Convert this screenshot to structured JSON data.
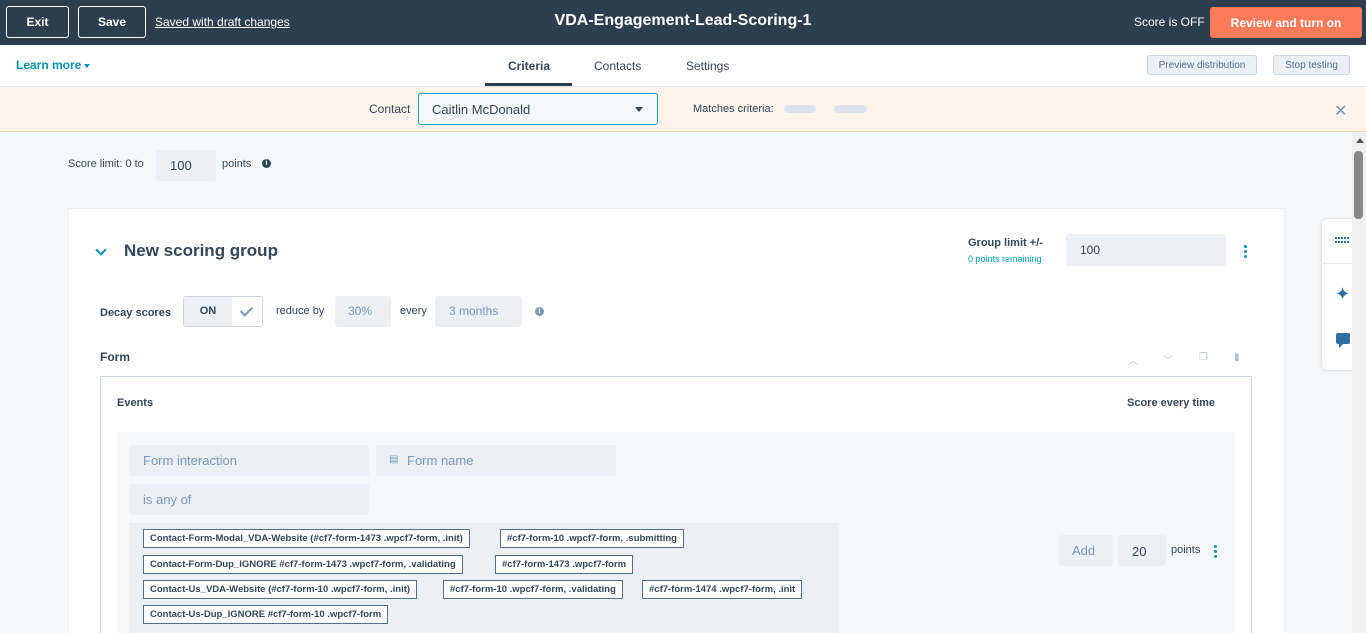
{
  "topbar": {
    "exit_label": "Exit",
    "save_label": "Save",
    "saved_status": "Saved with draft changes",
    "title": "VDA-Engagement-Lead-Scoring-1",
    "score_status": "Score is OFF",
    "review_label": "Review and turn on"
  },
  "tabbar": {
    "learn_more": "Learn more",
    "tabs": [
      {
        "label": "Criteria",
        "active": true
      },
      {
        "label": "Contacts",
        "active": false
      },
      {
        "label": "Settings",
        "active": false
      }
    ],
    "preview_label": "Preview distribution",
    "stop_label": "Stop testing"
  },
  "contactbar": {
    "label": "Contact",
    "selected_contact": "Caitlin McDonald",
    "matches_label": "Matches criteria:"
  },
  "score_limit": {
    "label": "Score limit: 0 to",
    "value": "100",
    "unit": "points"
  },
  "group": {
    "title": "New scoring group",
    "limit_label": "Group limit +/-",
    "points_remaining": "0 points remaining",
    "limit_value": "100",
    "decay_label": "Decay scores",
    "decay_toggle": "ON",
    "reduce_label": "reduce by",
    "reduce_value": "30%",
    "every_label": "every",
    "every_value": "3 months"
  },
  "form_section": {
    "label": "Form",
    "events_label": "Events",
    "score_mode": "Score every time",
    "event_type": "Form interaction",
    "property": "Form name",
    "operator": "is any of",
    "tags": [
      "Contact-Form-Modal_VDA-Website (#cf7-form-1473 .wpcf7-form, .init)",
      "#cf7-form-10 .wpcf7-form, .submitting",
      "Contact-Form-Dup_IGNORE #cf7-form-1473 .wpcf7-form, .validating",
      "#cf7-form-1473 .wpcf7-form",
      "Contact-Us_VDA-Website (#cf7-form-10 .wpcf7-form, .init)",
      "#cf7-form-10 .wpcf7-form, .validating",
      "#cf7-form-1474 .wpcf7-form, .init",
      "Contact-Us-Dup_IGNORE #cf7-form-10 .wpcf7-form"
    ],
    "action_label": "Add",
    "points_value": "20",
    "points_unit": "points"
  },
  "icons": {
    "close": "close-icon",
    "info": "info-icon",
    "chevron": "chevron-down-icon",
    "sparkle": "sparkle-icon",
    "chat": "chat-icon",
    "grid": "grid-icon"
  },
  "colors": {
    "topbar": "#2d3e50",
    "accent": "#ff7a59",
    "link": "#0091ae",
    "banner": "#fdf3ea"
  }
}
